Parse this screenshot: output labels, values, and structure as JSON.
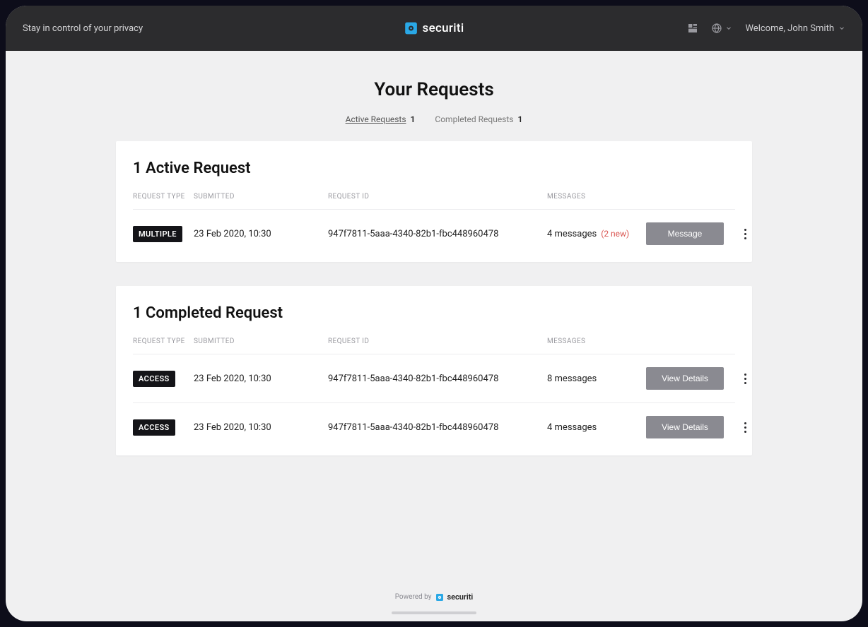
{
  "header": {
    "tagline": "Stay in control of your privacy",
    "brand_name": "securiti",
    "welcome_text": "Welcome, John Smith"
  },
  "page": {
    "title": "Your Requests"
  },
  "tabs": {
    "active": {
      "label": "Active Requests",
      "count": "1"
    },
    "completed": {
      "label": "Completed Requests",
      "count": "1"
    }
  },
  "columns": {
    "request_type": "REQUEST TYPE",
    "submitted": "SUBMITTED",
    "request_id": "REQUEST ID",
    "messages": "MESSAGES"
  },
  "active_section": {
    "heading": "1 Active Request",
    "rows": [
      {
        "type": "MULTIPLE",
        "submitted": "23 Feb 2020, 10:30",
        "id": "947f7811-5aaa-4340-82b1-fbc448960478",
        "messages": "4 messages",
        "new": "(2 new)",
        "action": "Message"
      }
    ]
  },
  "completed_section": {
    "heading": "1 Completed Request",
    "rows": [
      {
        "type": "ACCESS",
        "submitted": "23 Feb 2020, 10:30",
        "id": "947f7811-5aaa-4340-82b1-fbc448960478",
        "messages": "8 messages",
        "action": "View Details"
      },
      {
        "type": "ACCESS",
        "submitted": "23 Feb 2020, 10:30",
        "id": "947f7811-5aaa-4340-82b1-fbc448960478",
        "messages": "4 messages",
        "action": "View Details"
      }
    ]
  },
  "footer": {
    "powered_by": "Powered by",
    "brand": "securiti"
  }
}
